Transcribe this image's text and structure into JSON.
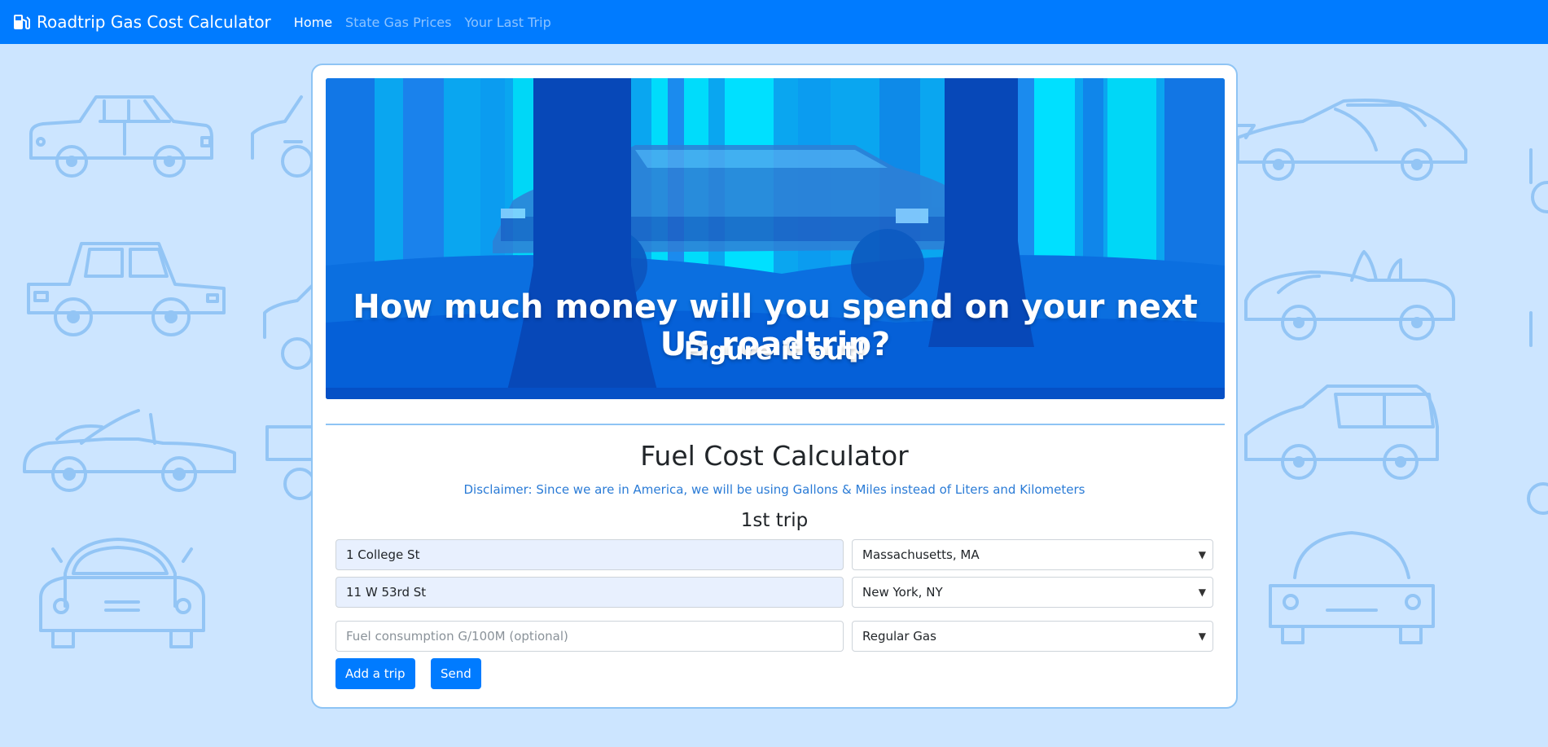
{
  "navbar": {
    "brand": "Roadtrip Gas Cost Calculator",
    "brand_icon": "gas-pump-icon",
    "links": [
      {
        "label": "Home",
        "active": true
      },
      {
        "label": "State Gas Prices",
        "active": false
      },
      {
        "label": "Your Last Trip",
        "active": false
      }
    ]
  },
  "hero": {
    "title": "How much money will you spend on your next US roadtrip?",
    "subtitle": "Figure it out!"
  },
  "calculator": {
    "title": "Fuel Cost Calculator",
    "disclaimer": "Disclaimer: Since we are in America, we will be using Gallons & Miles instead of Liters and Kilometers",
    "trip_label": "1st trip",
    "origin_address": "1 College St",
    "origin_state": "Massachusetts, MA",
    "destination_address": "11 W 53rd St",
    "destination_state": "New York, NY",
    "fuel_consumption_placeholder": "Fuel consumption G/100M (optional)",
    "fuel_type": "Regular Gas",
    "add_trip_label": "Add a trip",
    "send_label": "Send"
  },
  "colors": {
    "navbar": "#007bff",
    "background": "#cce5ff",
    "accent": "#2a7bd6",
    "card_border": "#8ec4f4"
  }
}
